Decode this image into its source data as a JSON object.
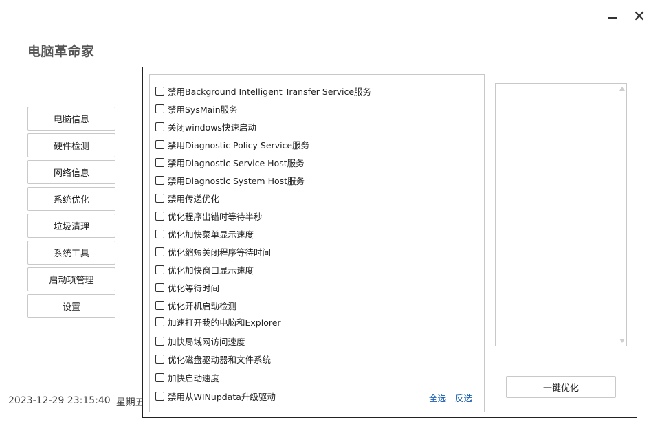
{
  "app": {
    "title": "电脑革命家"
  },
  "window_controls": {
    "minimize": "minimize-icon",
    "close": "close-icon"
  },
  "nav": {
    "items": [
      {
        "label": "电脑信息"
      },
      {
        "label": "硬件检测"
      },
      {
        "label": "网络信息"
      },
      {
        "label": "系统优化"
      },
      {
        "label": "垃圾清理"
      },
      {
        "label": "系统工具"
      },
      {
        "label": "启动项管理"
      },
      {
        "label": "设置"
      }
    ]
  },
  "status": {
    "date": "2023-12-29 23:15:40",
    "weekday": "星期五"
  },
  "options": [
    {
      "label": "禁用Background Intelligent Transfer Service服务",
      "checked": false
    },
    {
      "label": "禁用SysMain服务",
      "checked": false
    },
    {
      "label": "关闭windows快速启动",
      "checked": false
    },
    {
      "label": "禁用Diagnostic Policy Service服务",
      "checked": false
    },
    {
      "label": "禁用Diagnostic Service Host服务",
      "checked": false
    },
    {
      "label": "禁用Diagnostic System Host服务",
      "checked": false
    },
    {
      "label": "禁用传递优化",
      "checked": false
    },
    {
      "label": "优化程序出错时等待半秒",
      "checked": false
    },
    {
      "label": "优化加快菜单显示速度",
      "checked": false
    },
    {
      "label": "优化缩短关闭程序等待时间",
      "checked": false
    },
    {
      "label": "优化加快窗口显示速度",
      "checked": false
    },
    {
      "label": "优化等待时间",
      "checked": false
    },
    {
      "label": "优化开机启动检测",
      "checked": false
    },
    {
      "label": "加速打开我的电脑和Explorer",
      "checked": false
    },
    {
      "label": "加快局域网访问速度",
      "checked": false
    },
    {
      "label": "优化磁盘驱动器和文件系统",
      "checked": false
    },
    {
      "label": "加快启动速度",
      "checked": false
    },
    {
      "label": "禁用从WINupdata升级驱动",
      "checked": false
    }
  ],
  "selection": {
    "select_all": "全选",
    "invert": "反选"
  },
  "actions": {
    "optimize": "一键优化"
  },
  "colors": {
    "link": "#1a5fb4",
    "border": "#c8c8c8",
    "frame": "#222222"
  }
}
